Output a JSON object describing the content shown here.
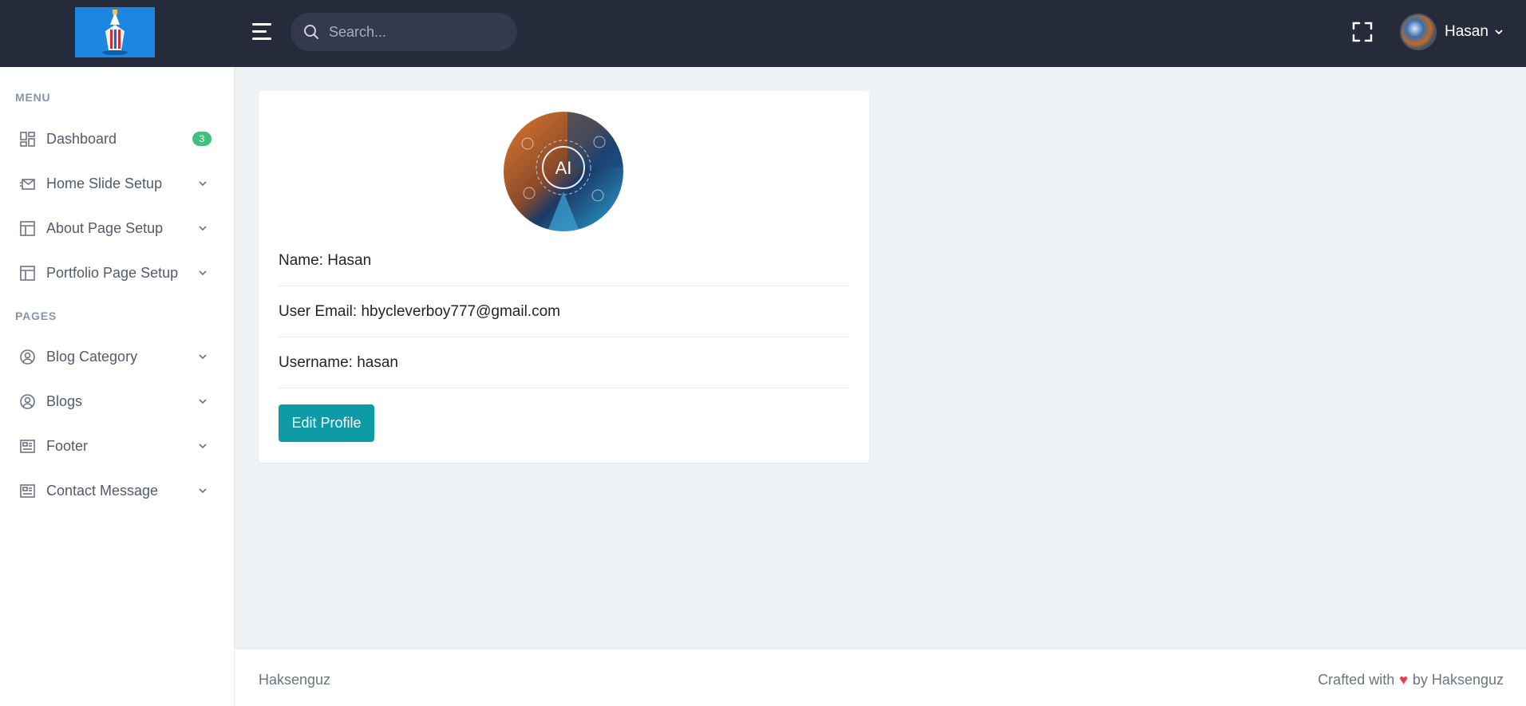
{
  "header": {
    "search_placeholder": "Search...",
    "user_name": "Hasan"
  },
  "sidebar": {
    "menu_title": "MENU",
    "pages_title": "PAGES",
    "dashboard_badge": "3",
    "items": [
      {
        "label": "Dashboard",
        "icon": "dashboard-icon"
      },
      {
        "label": "Home Slide Setup",
        "icon": "mail-icon"
      },
      {
        "label": "About Page Setup",
        "icon": "layout-icon"
      },
      {
        "label": "Portfolio Page Setup",
        "icon": "layout-icon"
      },
      {
        "label": "Blog Category",
        "icon": "user-circle-icon"
      },
      {
        "label": "Blogs",
        "icon": "user-circle-icon"
      },
      {
        "label": "Footer",
        "icon": "newspaper-icon"
      },
      {
        "label": "Contact Message",
        "icon": "newspaper-icon"
      }
    ]
  },
  "profile": {
    "name_line": "Name: Hasan",
    "email_line": "User Email: hbycleverboy777@gmail.com",
    "username_line": "Username: hasan",
    "edit_button": "Edit Profile"
  },
  "footer": {
    "left": "Haksenguz",
    "right_prefix": "Crafted with",
    "right_suffix": "by Haksenguz"
  },
  "colors": {
    "topbar": "#252b3b",
    "accent": "#0f9aa8",
    "badge": "#3fc07f",
    "heart": "#f1364a"
  }
}
